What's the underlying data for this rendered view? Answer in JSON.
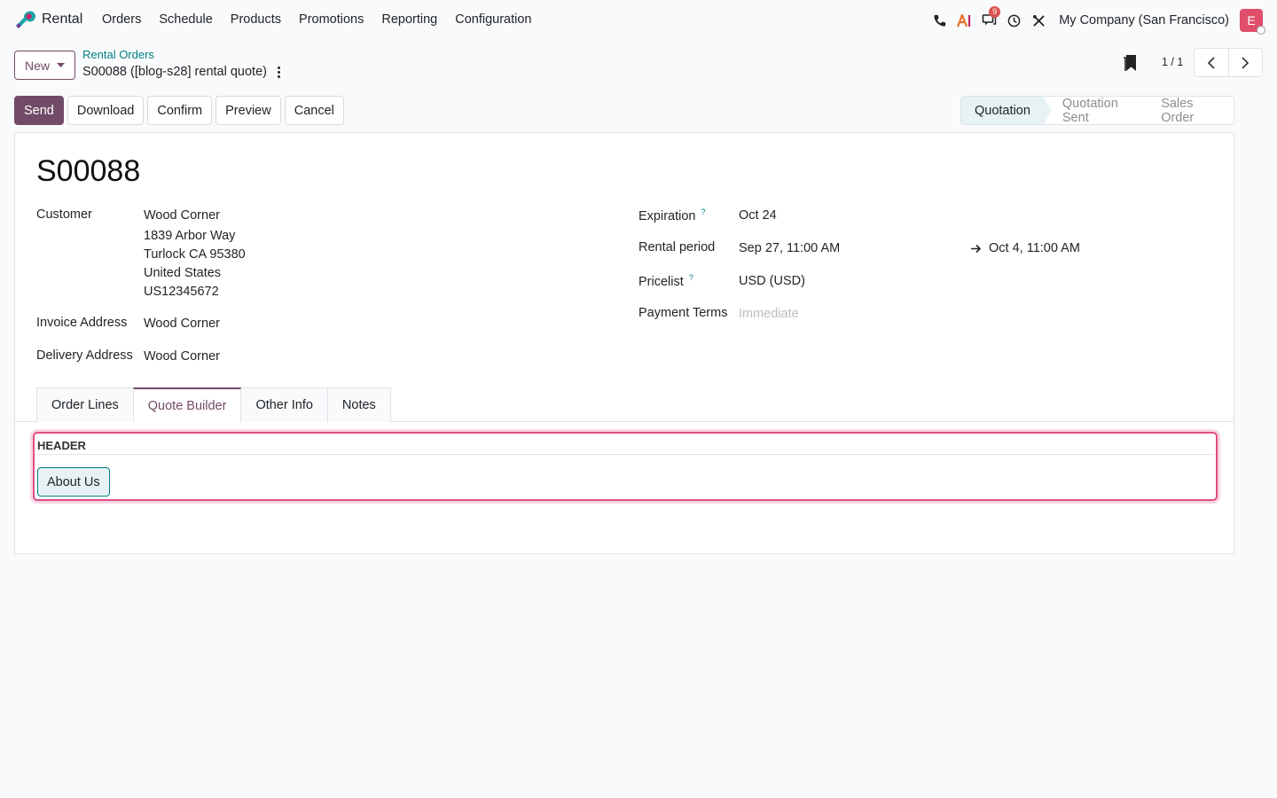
{
  "navbar": {
    "app_name": "Rental",
    "menu": [
      "Orders",
      "Schedule",
      "Products",
      "Promotions",
      "Reporting",
      "Configuration"
    ],
    "messages_badge": "9",
    "company": "My Company (San Francisco)",
    "avatar_letter": "E"
  },
  "control": {
    "new_label": "New",
    "breadcrumb_parent": "Rental Orders",
    "breadcrumb_current": "S00088 ([blog-s28] rental quote)",
    "pager_value": "1 / 1"
  },
  "actions": {
    "send": "Send",
    "download": "Download",
    "confirm": "Confirm",
    "preview": "Preview",
    "cancel": "Cancel"
  },
  "status": {
    "stages": [
      "Quotation",
      "Quotation Sent",
      "Sales Order"
    ],
    "active": "Quotation"
  },
  "form": {
    "name": "S00088",
    "customer_label": "Customer",
    "customer_name": "Wood Corner",
    "customer_street": "1839 Arbor Way",
    "customer_city": "Turlock CA 95380",
    "customer_country": "United States",
    "customer_vat": "US12345672",
    "invoice_label": "Invoice Address",
    "invoice_value": "Wood Corner",
    "delivery_label": "Delivery Address",
    "delivery_value": "Wood Corner",
    "expiration_label": "Expiration",
    "expiration_value": "Oct 24",
    "rental_label": "Rental period",
    "rental_start": "Sep 27, 11:00 AM",
    "rental_end": "Oct 4, 11:00 AM",
    "pricelist_label": "Pricelist",
    "pricelist_value": "USD (USD)",
    "payment_label": "Payment Terms",
    "payment_placeholder": "Immediate",
    "help_mark": "?"
  },
  "tabs": [
    "Order Lines",
    "Quote Builder",
    "Other Info",
    "Notes"
  ],
  "active_tab": "Quote Builder",
  "quote_builder": {
    "section_title": "HEADER",
    "document": "About Us"
  },
  "colors": {
    "brand": "#714b67",
    "link": "#017e84",
    "highlight_border": "#e04e85",
    "avatar": "#e04e6b"
  }
}
